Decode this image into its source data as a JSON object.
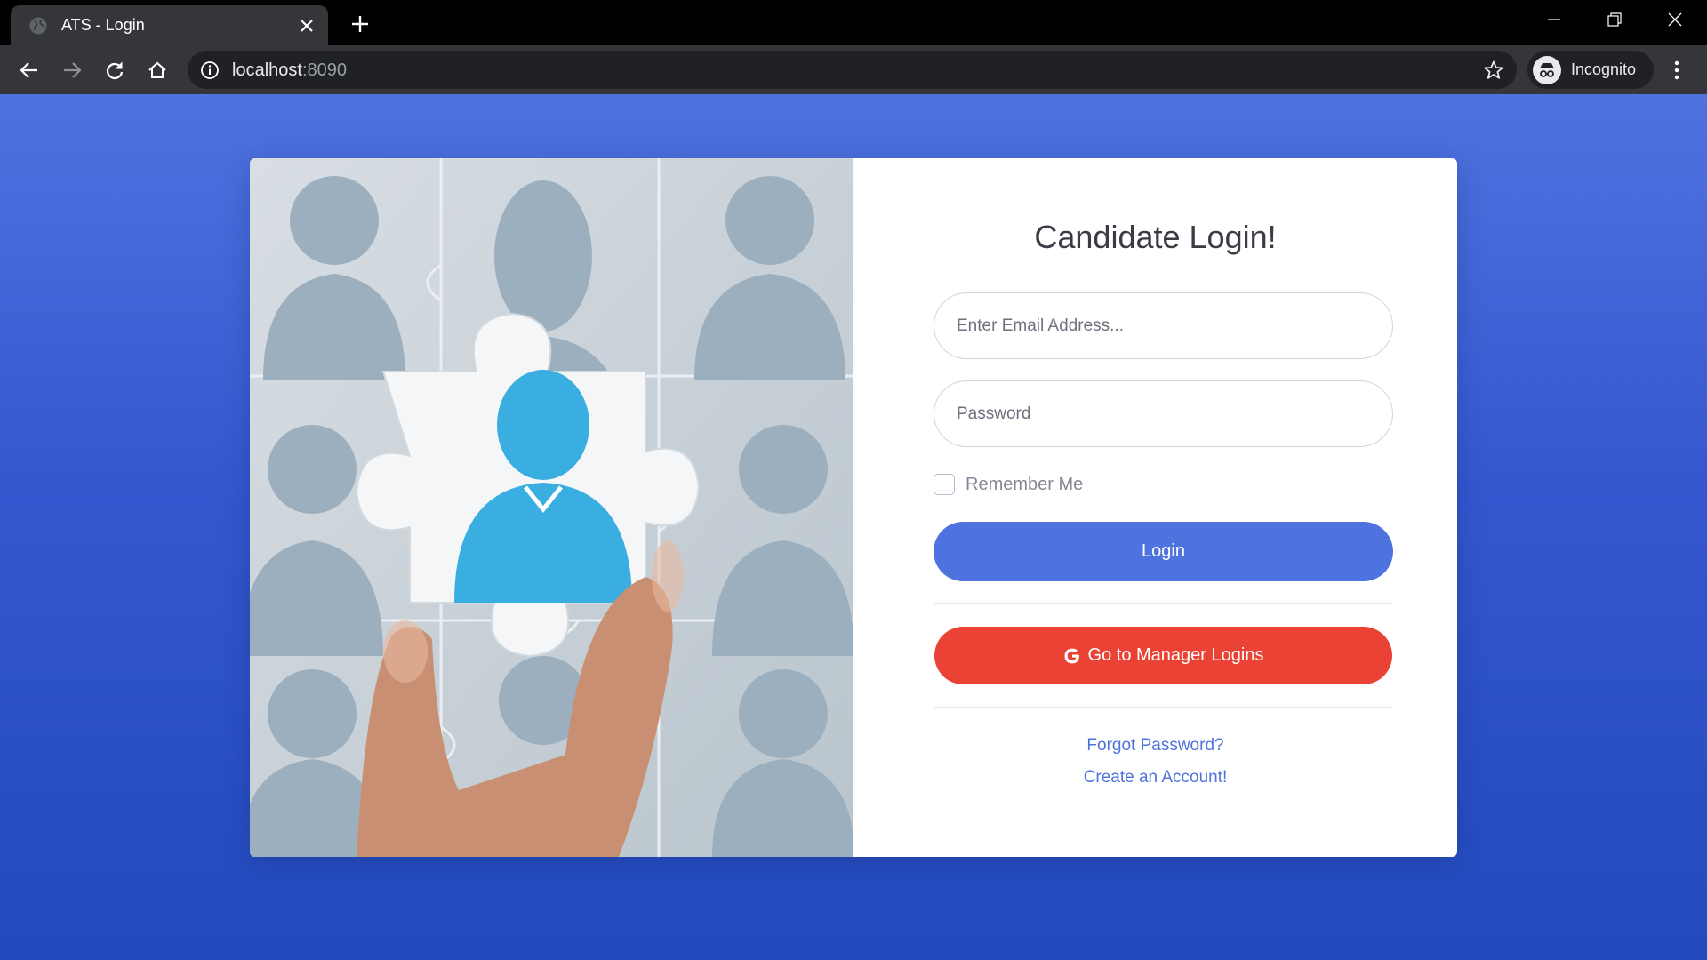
{
  "browser": {
    "tab_title": "ATS - Login",
    "url_host": "localhost",
    "url_port": ":8090",
    "profile_label": "Incognito",
    "icons": [
      "globe-icon",
      "close-icon",
      "plus-icon",
      "minimize-icon",
      "restore-icon",
      "window-close-icon",
      "back-icon",
      "forward-icon",
      "reload-icon",
      "home-icon",
      "info-icon",
      "star-icon",
      "incognito-icon",
      "menu-kebab-icon"
    ]
  },
  "page": {
    "theme": {
      "primary": "#4e73df",
      "danger": "#ea4335",
      "text": "#3a3b45",
      "muted": "#858796"
    },
    "hero_image": "puzzle piece with person silhouettes",
    "login_form": {
      "heading": "Candidate Login!",
      "email_placeholder": "Enter Email Address...",
      "password_placeholder": "Password",
      "remember_label": "Remember Me",
      "remember_checked": false,
      "login_button": "Login",
      "manager_button": "Go to Manager Logins",
      "manager_icon": "google-icon",
      "forgot_link": "Forgot Password?",
      "create_link": "Create an Account!"
    }
  }
}
